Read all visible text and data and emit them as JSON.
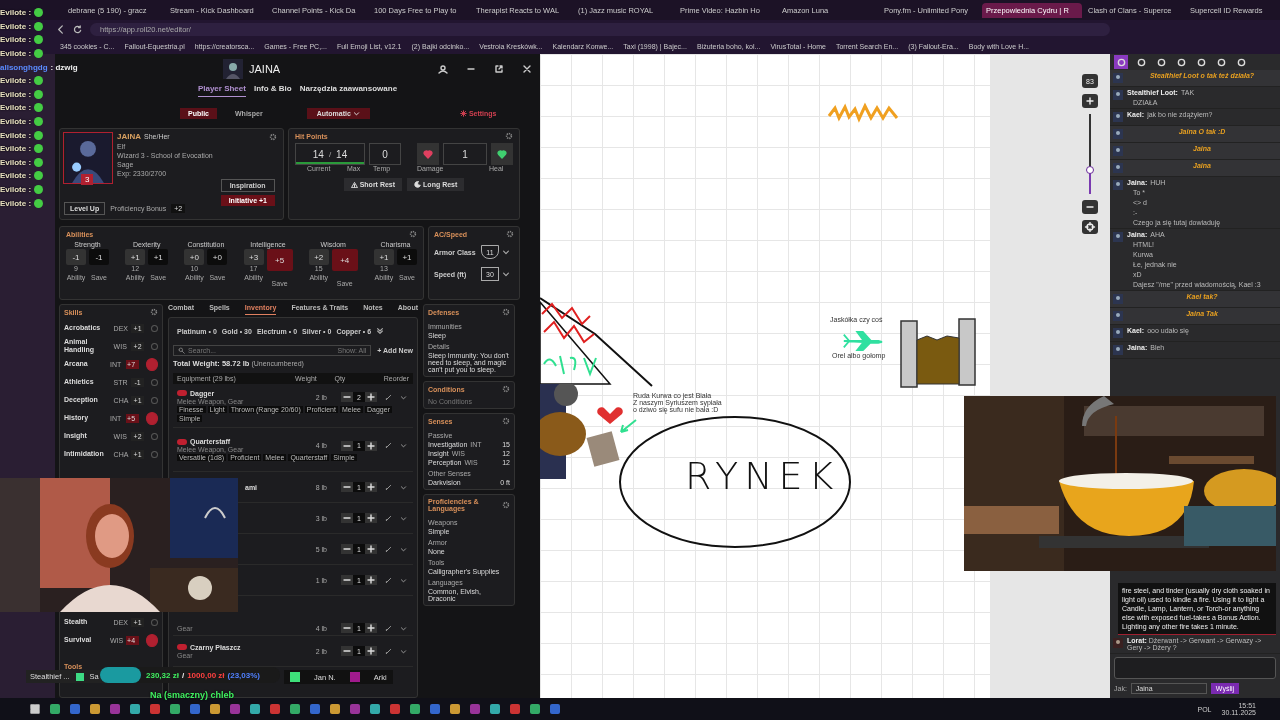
{
  "browser": {
    "tabs": [
      {
        "label": "debrane (5 190) - gracz",
        "selected": false
      },
      {
        "label": "Stream - Kick Dashboard",
        "selected": false
      },
      {
        "label": "Channel Points - Kick Da",
        "selected": false
      },
      {
        "label": "100 Days Free to Play to",
        "selected": false
      },
      {
        "label": "Therapist Reacts to WAL",
        "selected": false
      },
      {
        "label": "(1) Jazz music ROYAL",
        "selected": false
      },
      {
        "label": "Prime Video: Hazbin Ho",
        "selected": false
      },
      {
        "label": "Amazon Luna",
        "selected": false
      },
      {
        "label": "Pony.fm - Unlimited Pony",
        "selected": false
      },
      {
        "label": "Przepowiednia Cydru | R",
        "selected": true
      },
      {
        "label": "Clash of Clans - Superce",
        "selected": false
      },
      {
        "label": "Supercell ID Rewards",
        "selected": false
      }
    ],
    "url": "https://app.roll20.net/editor/",
    "bookmarks": [
      "345 cookies - C...",
      "Fallout-Equestria.pl",
      "https://creatorsca...",
      "Games - Free PC,...",
      "Full Emoji List, v12.1",
      "(2) Bajki odcinko...",
      "Vestroia Kreskówk...",
      "Kalendarz Konwe...",
      "Taxi (1998) | Bajec...",
      "Biżuteria boho, kol...",
      "VirusTotal - Home",
      "Torrent Search En...",
      "(3) Fallout-Era...",
      "Body with Love H..."
    ]
  },
  "stream_chat": {
    "top": [
      "Evilote :",
      "Evilote :",
      "Evilote :",
      "Evilote :"
    ],
    "user": "allsonghgdg",
    "message": ": dzwig",
    "rest": [
      "Evilote :",
      "Evilote :",
      "Evilote :",
      "Evilote :",
      "Evilote :",
      "Evilote :",
      "Evilote :",
      "Evilote :",
      "Evilote :",
      "Evilote :"
    ]
  },
  "sheet": {
    "title": "JAINA",
    "tabs": [
      {
        "label": "Player Sheet",
        "selected": true
      },
      {
        "label": "Info & Bio",
        "selected": false
      },
      {
        "label": "Narzędzia zaawansowane",
        "selected": false
      }
    ],
    "roll_modes": [
      {
        "label": "Public",
        "selected": true
      },
      {
        "label": "Whisper",
        "selected": false
      }
    ],
    "automatic": "Automatic",
    "settings": "Settings",
    "profile": {
      "name": "JAINA",
      "pronouns": "She/Her",
      "race": "Elf",
      "class": "Wizard 3 - School of Evocation",
      "background": "Sage",
      "exp": "Exp: 2330/2700",
      "level": "3",
      "level_up": "Level Up",
      "proficiency_label": "Proficiency Bonus",
      "proficiency": "+2",
      "inspiration": "Inspiration",
      "initiative": "Initiative +1"
    },
    "hit_points": {
      "title": "Hit Points",
      "current": "14",
      "slash": "/",
      "max": "14",
      "temp": "0",
      "amount": "1",
      "level": 1,
      "labels": [
        "Current",
        "Max",
        "Temp",
        "Damage",
        "Heal"
      ],
      "short_rest": "Short Rest",
      "long_rest": "Long Rest"
    },
    "abilities": {
      "title": "Abilities",
      "items": [
        {
          "name": "Strength",
          "mod": "-1",
          "score": "9",
          "ability_label": "Ability",
          "save": "-1",
          "save_label": "Save",
          "proficient": false
        },
        {
          "name": "Dexterity",
          "mod": "+1",
          "score": "12",
          "ability_label": "Ability",
          "save": "+1",
          "save_label": "Save",
          "proficient": false
        },
        {
          "name": "Constitution",
          "mod": "+0",
          "score": "10",
          "ability_label": "Ability",
          "save": "+0",
          "save_label": "Save",
          "proficient": false
        },
        {
          "name": "Intelligence",
          "mod": "+3",
          "score": "17",
          "ability_label": "Ability",
          "save": "+5",
          "save_label": "Save",
          "proficient": true
        },
        {
          "name": "Wisdom",
          "mod": "+2",
          "score": "15",
          "ability_label": "Ability",
          "save": "+4",
          "save_label": "Save",
          "proficient": true
        },
        {
          "name": "Charisma",
          "mod": "+1",
          "score": "13",
          "ability_label": "Ability",
          "save": "+1",
          "save_label": "Save",
          "proficient": false
        }
      ]
    },
    "ac_speed": {
      "title": "AC/Speed",
      "rows": [
        {
          "label": "Armor Class",
          "value": "11"
        },
        {
          "label": "Speed (ft)",
          "value": "30"
        }
      ]
    },
    "skills": {
      "title": "Skills",
      "items": [
        {
          "name": "Acrobatics",
          "ability": "DEX",
          "bonus": "+1",
          "proficient": false
        },
        {
          "name": "Animal Handling",
          "ability": "WIS",
          "bonus": "+2",
          "proficient": false
        },
        {
          "name": "Arcana",
          "ability": "INT",
          "bonus": "+7",
          "proficient": true
        },
        {
          "name": "Athletics",
          "ability": "STR",
          "bonus": "-1",
          "proficient": false
        },
        {
          "name": "Deception",
          "ability": "CHA",
          "bonus": "+1",
          "proficient": false
        },
        {
          "name": "History",
          "ability": "INT",
          "bonus": "+5",
          "proficient": true
        },
        {
          "name": "Insight",
          "ability": "WIS",
          "bonus": "+2",
          "proficient": false
        },
        {
          "name": "Intimidation",
          "ability": "CHA",
          "bonus": "+1",
          "proficient": false
        }
      ],
      "lower_items": [
        {
          "name": "Stealth",
          "ability": "DEX",
          "bonus": "+1",
          "proficient": false
        },
        {
          "name": "Survival",
          "ability": "WIS",
          "bonus": "+4",
          "proficient": true
        }
      ],
      "tools_title": "Tools"
    },
    "sections": [
      {
        "label": "Combat",
        "selected": false
      },
      {
        "label": "Spells",
        "selected": false
      },
      {
        "label": "Inventory",
        "selected": true
      },
      {
        "label": "Features & Traits",
        "selected": false
      },
      {
        "label": "Notes",
        "selected": false
      },
      {
        "label": "About",
        "selected": false
      }
    ],
    "inventory": {
      "currency": [
        "Platinum • 0",
        "Gold • 30",
        "Electrum • 0",
        "Silver • 0",
        "Copper • 6"
      ],
      "search_placeholder": "Search...",
      "filter": "Show: All",
      "add_new": "+ Add New",
      "total_weight": "Total Weight: 58.72 lb",
      "encumbrance": "(Unencumbered)",
      "columns": [
        "Equipment (29 lbs)",
        "Weight",
        "Qty",
        "Reorder"
      ],
      "items": [
        {
          "name": "Dagger",
          "type": "Melee Weapon, Gear",
          "tags": [
            "Finesse",
            "Light",
            "Thrown (Range 20/60)",
            "Proficient",
            "Melee",
            "Dagger",
            "Simple"
          ],
          "weight": "2 lb",
          "qty": "2",
          "equipped": true
        },
        {
          "name": "Quarterstaff",
          "type": "Melee Weapon, Gear",
          "tags": [
            "Versatile (1d8)",
            "Proficient",
            "Melee",
            "Quarterstaff",
            "Simple"
          ],
          "weight": "4 lb",
          "qty": "1",
          "equipped": true
        },
        {
          "name": "ami",
          "weight": "8 lb",
          "qty": "1"
        },
        {
          "weight": "3 lb",
          "qty": "1"
        },
        {
          "weight": "5 lb",
          "qty": "1"
        },
        {
          "weight": "1 lb",
          "qty": "1"
        },
        {
          "type": "Gear",
          "weight": "4 lb",
          "qty": "1"
        },
        {
          "name": "Czarny Płaszcz",
          "type": "Gear",
          "weight": "2 lb",
          "qty": "1",
          "equipped": true
        }
      ]
    },
    "defenses": {
      "title": "Defenses",
      "immunities_label": "Immunities",
      "immunities": "Sleep",
      "details_label": "Details",
      "details": "Sleep Immunity: You don't need to sleep, and magic can't put you to sleep."
    },
    "conditions": {
      "title": "Conditions",
      "text": "No Conditions"
    },
    "senses": {
      "title": "Senses",
      "passive_label": "Passive",
      "passive": [
        {
          "name": "Investigation",
          "ability": "INT",
          "value": "15"
        },
        {
          "name": "Insight",
          "ability": "WIS",
          "value": "12"
        },
        {
          "name": "Perception",
          "ability": "WIS",
          "value": "12"
        }
      ],
      "other_label": "Other Senses",
      "other": [
        {
          "name": "Darkvision",
          "value": "0 ft"
        }
      ]
    },
    "proficiencies": {
      "title": "Proficiencies & Languages",
      "groups": [
        {
          "label": "Weapons",
          "value": "Simple"
        },
        {
          "label": "Armor",
          "value": "None"
        },
        {
          "label": "Tools",
          "value": "Calligrapher's Supplies"
        },
        {
          "label": "Languages",
          "value": "Common, Elvish, Draconic"
        }
      ]
    }
  },
  "canvas": {
    "bird_top": "Jaskółka czy coś",
    "bird_bottom": "Orel albo gołomp",
    "poem": [
      "Ruda Kurwa co jest Biała",
      "Z naszym Syriuszem sypiała",
      "o dziwo się sufu nie bała :D"
    ],
    "market": "RYNEK",
    "zoom": "83",
    "zoom_slider": {
      "level": 0.3
    }
  },
  "chat": {
    "tabs": [
      {
        "selected": true
      },
      {
        "selected": false
      },
      {
        "selected": false
      },
      {
        "selected": false
      },
      {
        "selected": false
      },
      {
        "selected": false
      },
      {
        "selected": false
      }
    ],
    "messages": [
      {
        "kind": "emote",
        "text": "Stealthief Loot o tak też działa?"
      },
      {
        "kind": "say",
        "who": "Stealthief Loot:",
        "lines": [
          "TAK",
          "DZIAŁA"
        ]
      },
      {
        "kind": "say",
        "who": "Kael:",
        "lines": [
          "jak bo nie zdążyłem?"
        ]
      },
      {
        "kind": "emote",
        "text": "Jaina O tak :D"
      },
      {
        "kind": "emote",
        "text": "Jaina"
      },
      {
        "kind": "emote",
        "text": "Jaina"
      },
      {
        "kind": "say",
        "who": "Jaina:",
        "lines": [
          "HUH",
          "To *",
          "<> d",
          ":-",
          "Czego ja się tutaj dowiaduję"
        ]
      },
      {
        "kind": "say",
        "who": "Jaina:",
        "lines": [
          "AHA",
          "HTML!",
          "Kurwa",
          "Łe, jednak nie",
          "xD",
          "Dajesz \"/me\" przed wiadomością, Kael :3"
        ]
      },
      {
        "kind": "emote",
        "text": "Kael tak?"
      },
      {
        "kind": "emote",
        "text": "Jaina Tak"
      },
      {
        "kind": "say",
        "who": "Kael:",
        "lines": [
          "ooo udało się"
        ]
      },
      {
        "kind": "say",
        "who": "Jaina:",
        "lines": [
          "Bleh"
        ]
      }
    ],
    "card": "fire steel, and tinder (usually dry cloth soaked in light oil) used to kindle a fire. Using it to light a Candle, Lamp, Lantern, or Torch-or anything else with exposed fuel-takes a Bonus Action. Lighting any other fire takes 1 minute.",
    "last": "**Lorat:** Dżerwant -> Gerwant -> Gerwazy -> Gery -> Dżery ?",
    "as_label": "Jak:",
    "as_value": "Jaina",
    "send": "Wyślij"
  },
  "overlay": {
    "users": [
      {
        "name": "Stealthief ...",
        "color": "#3ddc84"
      },
      {
        "name": "Sa"
      }
    ],
    "goal": {
      "raised": "230,32 zł",
      "slash": "/",
      "target": "1000,00 zł",
      "percent": "(23,03%)",
      "level": 0.23
    },
    "supporters": [
      {
        "name": "Jan N.",
        "color": "#3ee07a"
      },
      {
        "name": "Arki",
        "color": "#a01a8c"
      }
    ],
    "caption": "Na (smaczny) chleb"
  },
  "taskbar": {
    "language": "POL",
    "time": "15:51",
    "date": "30.11.2025"
  }
}
